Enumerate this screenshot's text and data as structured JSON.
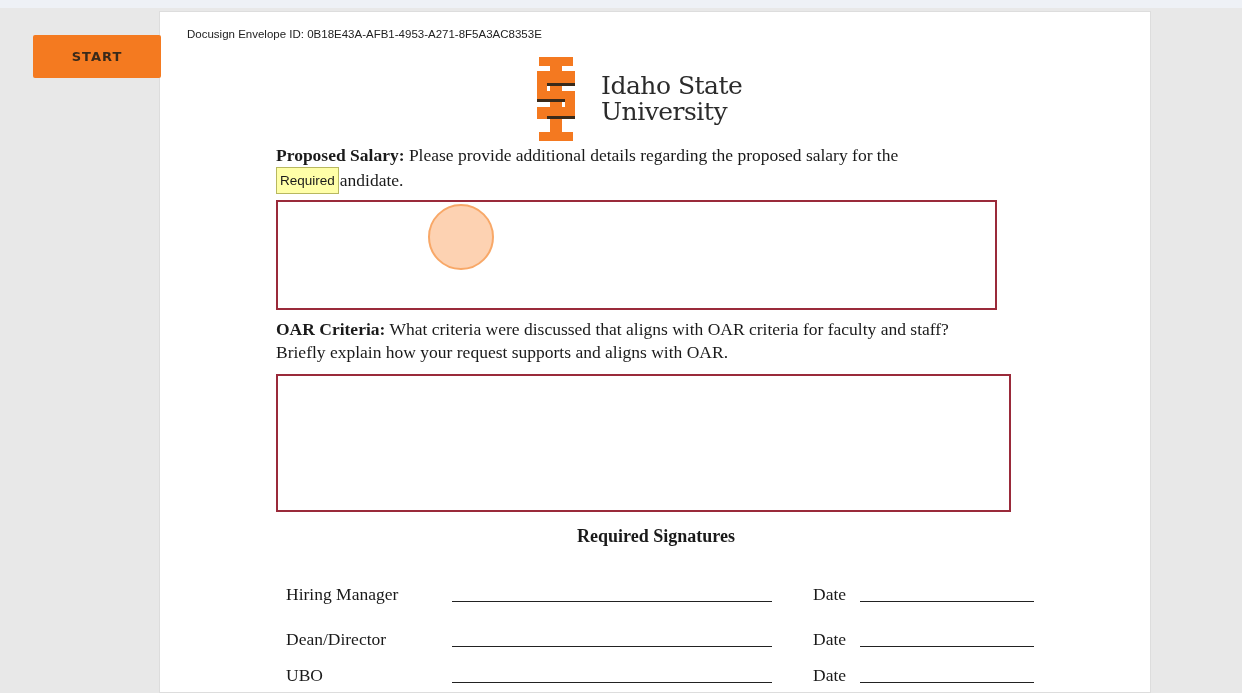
{
  "start_button": {
    "label": "START"
  },
  "document": {
    "envelope_id": "Docusign Envelope ID: 0B18E43A-AFB1-4953-A271-8F5A3AC8353E",
    "logo": {
      "lines": [
        "Idaho State",
        "University"
      ]
    },
    "sections": [
      {
        "prompt": "**Proposed Salary:** Please provide additional details regarding the proposed salary for the",
        "tooltip": "Required",
        "prompt_continued": "andidate."
      },
      {
        "prompt": "**OAR Criteria:** What criteria were discussed that aligns with OAR criteria for faculty and staff? Briefly explain how your request supports and aligns with OAR."
      }
    ],
    "signatures_heading": "Required Signatures",
    "signatures": [
      {
        "label": "Hiring Manager",
        "date_label": "Date"
      },
      {
        "label": "Dean/Director",
        "date_label": "Date"
      },
      {
        "label": "UBO",
        "date_label": "Date"
      }
    ]
  }
}
